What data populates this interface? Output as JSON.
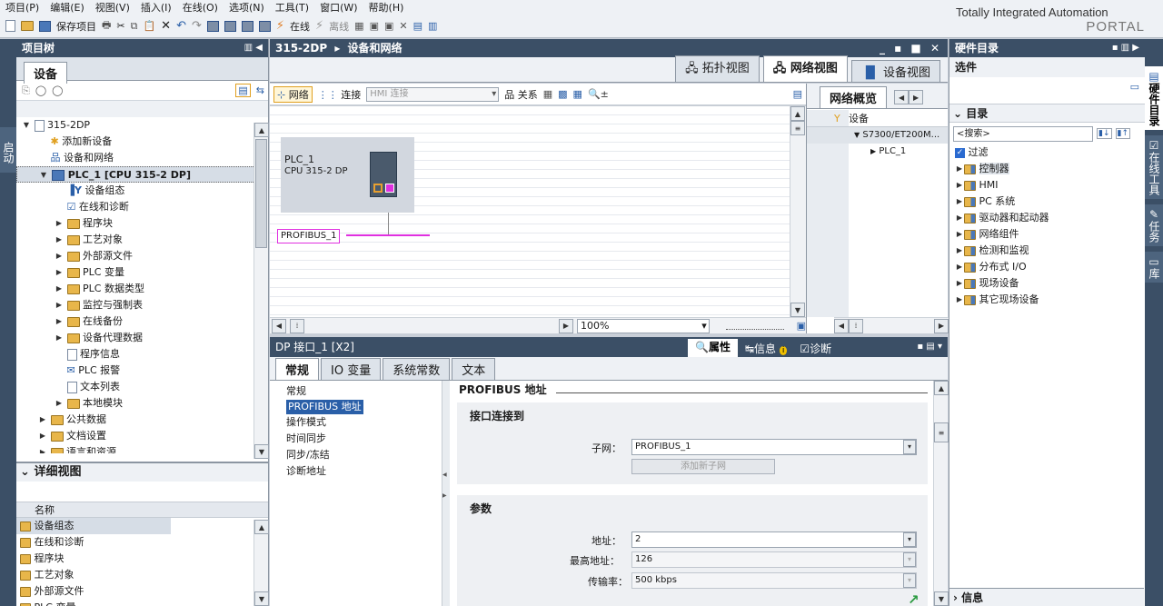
{
  "menu": [
    "项目(P)",
    "编辑(E)",
    "视图(V)",
    "插入(I)",
    "在线(O)",
    "选项(N)",
    "工具(T)",
    "窗口(W)",
    "帮助(H)"
  ],
  "toolbar": {
    "save_project": "保存项目",
    "online": "在线",
    "offline": "离线"
  },
  "branding": {
    "line1": "Totally Integrated Automation",
    "line2": "PORTAL"
  },
  "left_vtab": "启动",
  "project_tree": {
    "title": "项目树",
    "tab": "设备",
    "items": [
      {
        "label": "315-2DP",
        "indent": 0,
        "expand": "▼",
        "icon": "doc"
      },
      {
        "label": "添加新设备",
        "indent": 1,
        "expand": "",
        "icon": "star"
      },
      {
        "label": "设备和网络",
        "indent": 1,
        "expand": "",
        "icon": "net"
      },
      {
        "label": "PLC_1 [CPU 315-2 DP]",
        "indent": 1,
        "expand": "▼",
        "icon": "plc",
        "sel": true
      },
      {
        "label": "设备组态",
        "indent": 2,
        "expand": "",
        "icon": "cfg"
      },
      {
        "label": "在线和诊断",
        "indent": 2,
        "expand": "",
        "icon": "diag"
      },
      {
        "label": "程序块",
        "indent": 2,
        "expand": "▶",
        "icon": "fld"
      },
      {
        "label": "工艺对象",
        "indent": 2,
        "expand": "▶",
        "icon": "fld"
      },
      {
        "label": "外部源文件",
        "indent": 2,
        "expand": "▶",
        "icon": "fld"
      },
      {
        "label": "PLC 变量",
        "indent": 2,
        "expand": "▶",
        "icon": "fld"
      },
      {
        "label": "PLC 数据类型",
        "indent": 2,
        "expand": "▶",
        "icon": "fld"
      },
      {
        "label": "监控与强制表",
        "indent": 2,
        "expand": "▶",
        "icon": "fld"
      },
      {
        "label": "在线备份",
        "indent": 2,
        "expand": "▶",
        "icon": "fld"
      },
      {
        "label": "设备代理数据",
        "indent": 2,
        "expand": "▶",
        "icon": "fld"
      },
      {
        "label": "程序信息",
        "indent": 2,
        "expand": "",
        "icon": "doc"
      },
      {
        "label": "PLC 报警",
        "indent": 2,
        "expand": "",
        "icon": "mail"
      },
      {
        "label": "文本列表",
        "indent": 2,
        "expand": "",
        "icon": "doc"
      },
      {
        "label": "本地模块",
        "indent": 2,
        "expand": "▶",
        "icon": "fld"
      },
      {
        "label": "公共数据",
        "indent": 1,
        "expand": "▶",
        "icon": "fld"
      },
      {
        "label": "文档设置",
        "indent": 1,
        "expand": "▶",
        "icon": "fld"
      },
      {
        "label": "语言和资源",
        "indent": 1,
        "expand": "▶",
        "icon": "fld"
      }
    ]
  },
  "detail_view": {
    "title": "详细视图",
    "col": "名称",
    "items": [
      "设备组态",
      "在线和诊断",
      "程序块",
      "工艺对象",
      "外部源文件",
      "PLC 变量"
    ]
  },
  "editor": {
    "breadcrumb": [
      "315-2DP",
      "设备和网络"
    ],
    "view_tabs": [
      "拓扑视图",
      "网络视图",
      "设备视图"
    ],
    "net_toolbar": {
      "network": "网络",
      "connect": "连接",
      "conn_type": "HMI 连接",
      "relations": "关系"
    },
    "plc": {
      "name": "PLC_1",
      "model": "CPU 315-2 DP"
    },
    "bus": "PROFIBUS_1",
    "zoom": "100%",
    "overview": {
      "title": "网络概览",
      "col": "设备",
      "rows": [
        "S7300/ET200M...",
        "PLC_1"
      ]
    }
  },
  "properties": {
    "title": "DP 接口_1 [X2]",
    "tabs_right": [
      "属性",
      "信息",
      "诊断"
    ],
    "tabs": [
      "常规",
      "IO 变量",
      "系统常数",
      "文本"
    ],
    "nav": [
      "常规",
      "PROFIBUS 地址",
      "操作模式",
      "时间同步",
      "同步/冻结",
      "诊断地址"
    ],
    "section": "PROFIBUS 地址",
    "iface": {
      "title": "接口连接到",
      "subnet_label": "子网：",
      "subnet": "PROFIBUS_1",
      "add_btn": "添加新子网"
    },
    "params": {
      "title": "参数",
      "addr_label": "地址：",
      "addr": "2",
      "max_label": "最高地址：",
      "max": "126",
      "rate_label": "传输率：",
      "rate": "500 kbps"
    }
  },
  "catalog": {
    "title": "硬件目录",
    "options": "选件",
    "dir": "目录",
    "search_placeholder": "<搜索>",
    "filter": "过滤",
    "items": [
      "控制器",
      "HMI",
      "PC 系统",
      "驱动器和起动器",
      "网络组件",
      "检测和监视",
      "分布式 I/O",
      "现场设备",
      "其它现场设备"
    ],
    "info": "信息"
  },
  "right_vtabs": [
    "硬件目录",
    "在线工具",
    "任务",
    "库"
  ]
}
